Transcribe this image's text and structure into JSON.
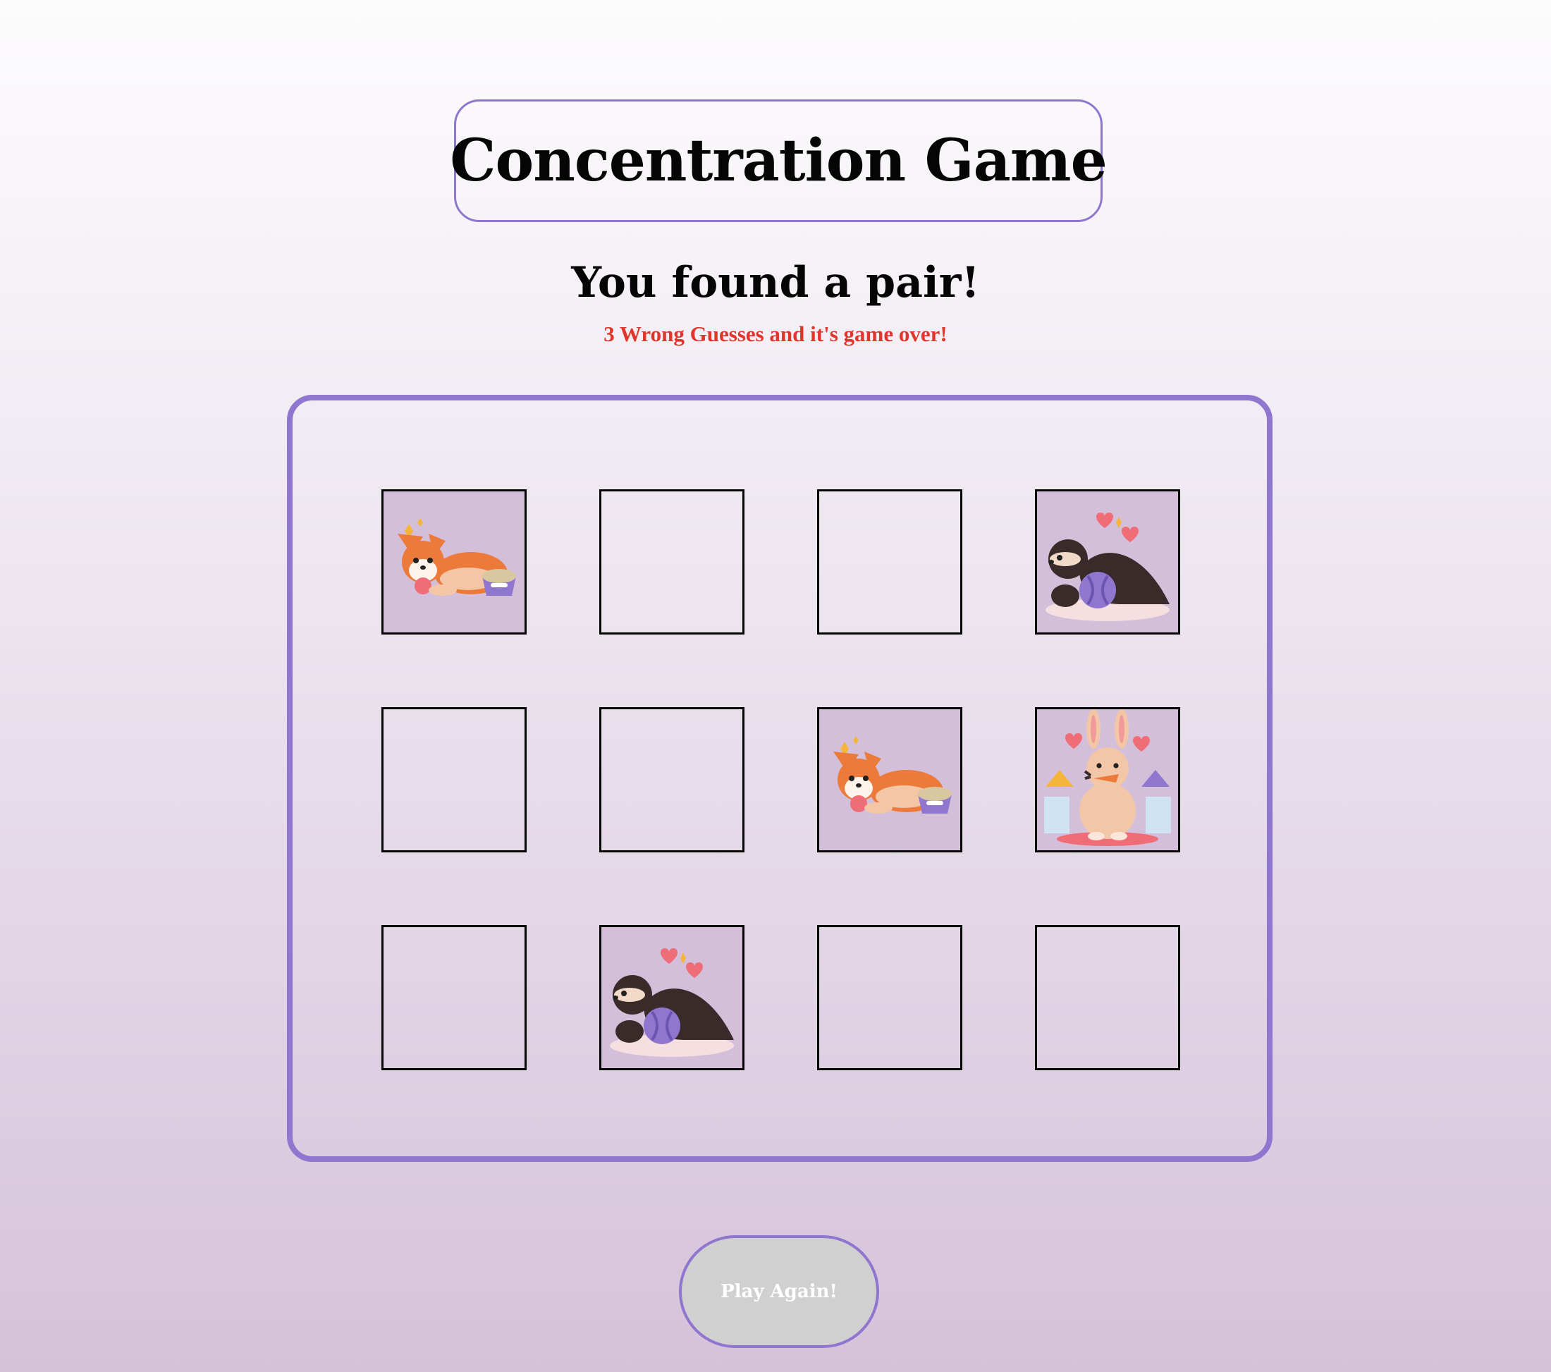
{
  "header": {
    "title": "Concentration Game"
  },
  "status": {
    "message": "You found a pair!",
    "warning": "3 Wrong Guesses and it's game over!",
    "warning_color": "#e0352b"
  },
  "board": {
    "rows": 3,
    "columns": 4,
    "cards": [
      {
        "state": "revealed",
        "animal": "corgi"
      },
      {
        "state": "hidden",
        "animal": ""
      },
      {
        "state": "hidden",
        "animal": ""
      },
      {
        "state": "revealed",
        "animal": "ferret"
      },
      {
        "state": "hidden",
        "animal": ""
      },
      {
        "state": "hidden",
        "animal": ""
      },
      {
        "state": "revealed",
        "animal": "corgi"
      },
      {
        "state": "revealed",
        "animal": "bunny"
      },
      {
        "state": "hidden",
        "animal": ""
      },
      {
        "state": "revealed",
        "animal": "ferret"
      },
      {
        "state": "hidden",
        "animal": ""
      },
      {
        "state": "hidden",
        "animal": ""
      }
    ]
  },
  "controls": {
    "play_again_label": "Play Again!"
  },
  "colors": {
    "accent": "#8f76cf",
    "card_back": "#d3bfd9",
    "button_bg": "#d1d0d0"
  }
}
